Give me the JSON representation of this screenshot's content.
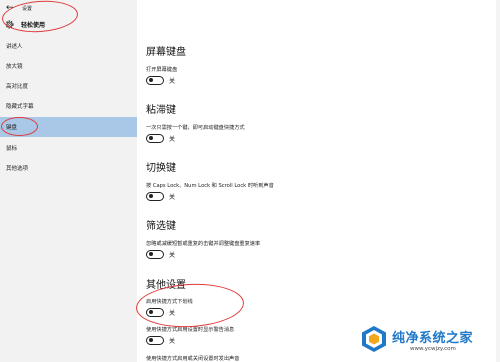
{
  "window": {
    "title": "设置",
    "back_icon": "back-arrow-icon"
  },
  "sidebar": {
    "header": {
      "icon": "gear-icon",
      "label": "轻松使用"
    },
    "items": [
      {
        "label": "讲述人"
      },
      {
        "label": "放大镜"
      },
      {
        "label": "高对比度"
      },
      {
        "label": "隐藏式字幕"
      },
      {
        "label": "键盘",
        "selected": true
      },
      {
        "label": "鼠标"
      },
      {
        "label": "其他选项"
      }
    ],
    "selected_color": "#a9c8e8"
  },
  "sections": [
    {
      "title": "屏幕键盘",
      "rows": [
        {
          "desc": "打开屏幕键盘",
          "state": "关"
        }
      ]
    },
    {
      "title": "粘滞键",
      "rows": [
        {
          "desc": "一次只需按一个键，即可启动键盘快捷方式",
          "state": "关"
        }
      ]
    },
    {
      "title": "切换键",
      "rows": [
        {
          "desc": "按 Caps Lock、Num Lock 和 Scroll Lock 时听到声音",
          "state": "关"
        }
      ]
    },
    {
      "title": "筛选键",
      "rows": [
        {
          "desc": "忽略或减缓短暂或重复的击键并调整键盘重复速率",
          "state": "关"
        }
      ]
    },
    {
      "title": "其他设置",
      "rows": [
        {
          "desc": "启用快捷方式下划线",
          "state": "关"
        },
        {
          "desc": "使用快捷方式启用设置时显示警告消息",
          "state": "关"
        },
        {
          "desc": "使用快捷方式启用或关闭设置时发出声音"
        }
      ]
    }
  ],
  "annotation_color": "#e03a3a",
  "watermark": {
    "text": "纯净系统之家",
    "url": "www.ycwjzy.com",
    "color": "#1f78c8"
  }
}
